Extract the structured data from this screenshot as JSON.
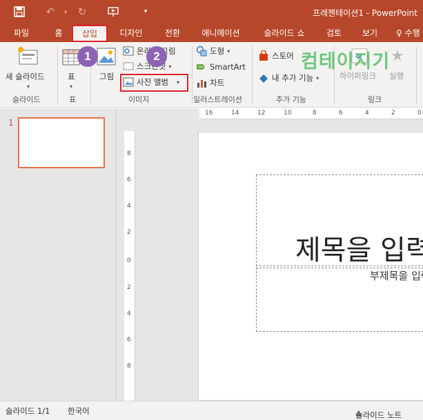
{
  "titlebar": {
    "doc_title": "프레젠테이션1 - PowerPoint",
    "quick_access": [
      "save-icon",
      "undo-icon",
      "redo-icon",
      "start-from-beginning-icon",
      "customize-icon"
    ]
  },
  "tabs": [
    {
      "label": "파일"
    },
    {
      "label": "홈"
    },
    {
      "label": "삽입",
      "active": true
    },
    {
      "label": "디자인"
    },
    {
      "label": "전환"
    },
    {
      "label": "애니메이션"
    },
    {
      "label": "슬라이드 쇼"
    },
    {
      "label": "검토"
    },
    {
      "label": "보기"
    },
    {
      "label": "수행"
    }
  ],
  "ribbon": {
    "slides_group": {
      "label": "슬라이드",
      "new_slide": "새 슬라이드"
    },
    "table_group": {
      "label": "표",
      "table": "표"
    },
    "images_group": {
      "label": "이미지",
      "picture": "그림",
      "online_pictures": "온라인 그림",
      "screenshot": "스크린샷",
      "photo_album": "사진 앨범"
    },
    "illustrations_group": {
      "label": "일러스트레이션",
      "shapes": "도형",
      "smartart": "SmartArt",
      "chart": "차트"
    },
    "addins_group": {
      "label": "추가 기능",
      "store": "스토어",
      "my_addins": "내 추가 기능"
    },
    "links_group": {
      "label": "링크",
      "hyperlink": "하이퍼링크",
      "action": "실행"
    }
  },
  "callouts": {
    "one": "1",
    "two": "2"
  },
  "thumbnails": {
    "slide_number": "1"
  },
  "ruler": {
    "horizontal": [
      "16",
      "14",
      "12",
      "10",
      "8",
      "6",
      "4",
      "2",
      "0"
    ],
    "vertical": [
      "8",
      "6",
      "4",
      "2",
      "0",
      "2",
      "4",
      "6",
      "8"
    ]
  },
  "slide": {
    "title_placeholder": "제목을 입력하십시오",
    "subtitle_placeholder": "부제목을 입력하십시오"
  },
  "statusbar": {
    "slide_count": "슬라이드 1/1",
    "language": "한국어",
    "notes": "슬라이드 노트"
  },
  "watermark": "컴테이지기",
  "colors": {
    "accent": "#b7472a",
    "callout": "#8e63b5",
    "highlight": "#e0202a"
  }
}
